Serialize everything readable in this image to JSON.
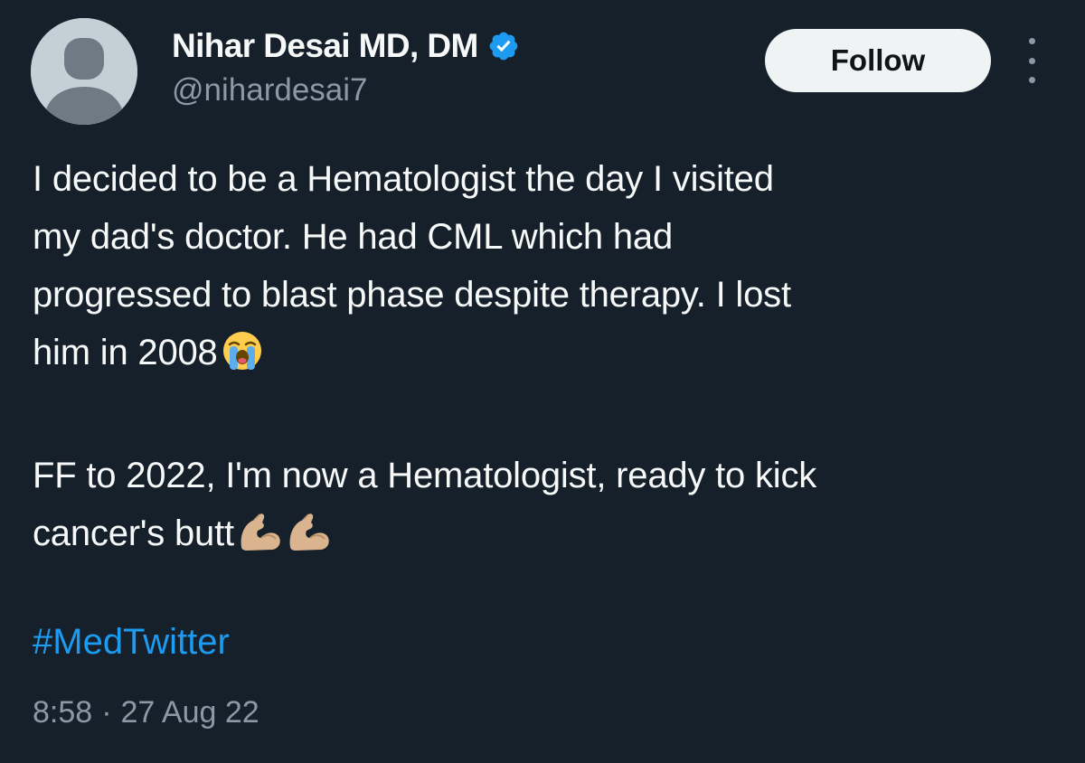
{
  "theme": {
    "background": "#15202b",
    "text_primary": "#f7f9f9",
    "text_secondary": "#8b98a5",
    "link": "#1d9bf0",
    "verified": "#1d9bf0",
    "button_bg": "#eff3f4"
  },
  "author": {
    "display_name": "Nihar Desai MD, DM",
    "handle": "@nihardesai7",
    "verified_icon": "verified-badge-icon",
    "avatar_icon": "default-avatar-icon"
  },
  "actions": {
    "follow_label": "Follow",
    "more_icon": "more-vertical-icon"
  },
  "tweet": {
    "lines_p1": [
      "I decided to be a Hematologist the day I visited",
      "my dad's doctor. He had CML which had",
      "progressed to blast phase despite therapy. I lost",
      "him in 2008"
    ],
    "emoji_p1": "loudly-crying-face-emoji",
    "lines_p2": [
      "FF to 2022, I'm now a Hematologist, ready to kick",
      "cancer's butt"
    ],
    "emoji_p2": [
      "flexed-biceps-emoji",
      "flexed-biceps-emoji"
    ],
    "hashtag": "#MedTwitter",
    "time": "8:58",
    "separator": "·",
    "date": "27 Aug 22"
  }
}
